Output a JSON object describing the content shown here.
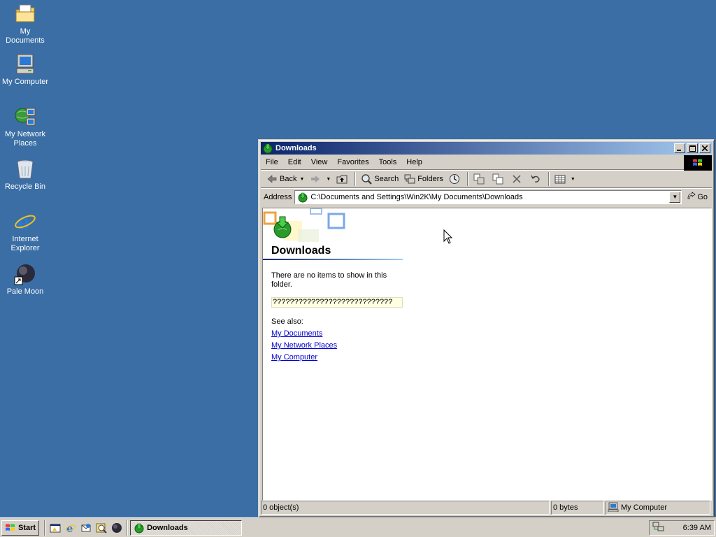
{
  "desktop": {
    "icons": [
      {
        "label": "My Documents"
      },
      {
        "label": "My Computer"
      },
      {
        "label": "My Network Places"
      },
      {
        "label": "Recycle Bin"
      },
      {
        "label": "Internet Explorer"
      },
      {
        "label": "Pale Moon"
      }
    ]
  },
  "window": {
    "title": "Downloads",
    "menu": [
      "File",
      "Edit",
      "View",
      "Favorites",
      "Tools",
      "Help"
    ],
    "toolbar": {
      "back": "Back",
      "search": "Search",
      "folders": "Folders"
    },
    "address": {
      "label": "Address",
      "value": "C:\\Documents and Settings\\Win2K\\My Documents\\Downloads",
      "go": "Go"
    },
    "content": {
      "folder_title": "Downloads",
      "empty_message": "There are no items to show in this folder.",
      "info_text": "????????????????????????????",
      "see_also": "See also:",
      "links": [
        "My Documents",
        "My Network Places",
        "My Computer"
      ]
    },
    "status": {
      "objects": "0 object(s)",
      "size": "0 bytes",
      "zone": "My Computer"
    }
  },
  "taskbar": {
    "start": "Start",
    "task": "Downloads",
    "clock": "6:39 AM"
  },
  "colors": {
    "desktop": "#3a6ea5",
    "title_active_start": "#0a246a",
    "title_active_end": "#a6caf0",
    "face": "#d4d0c8",
    "link": "#0000cc"
  }
}
